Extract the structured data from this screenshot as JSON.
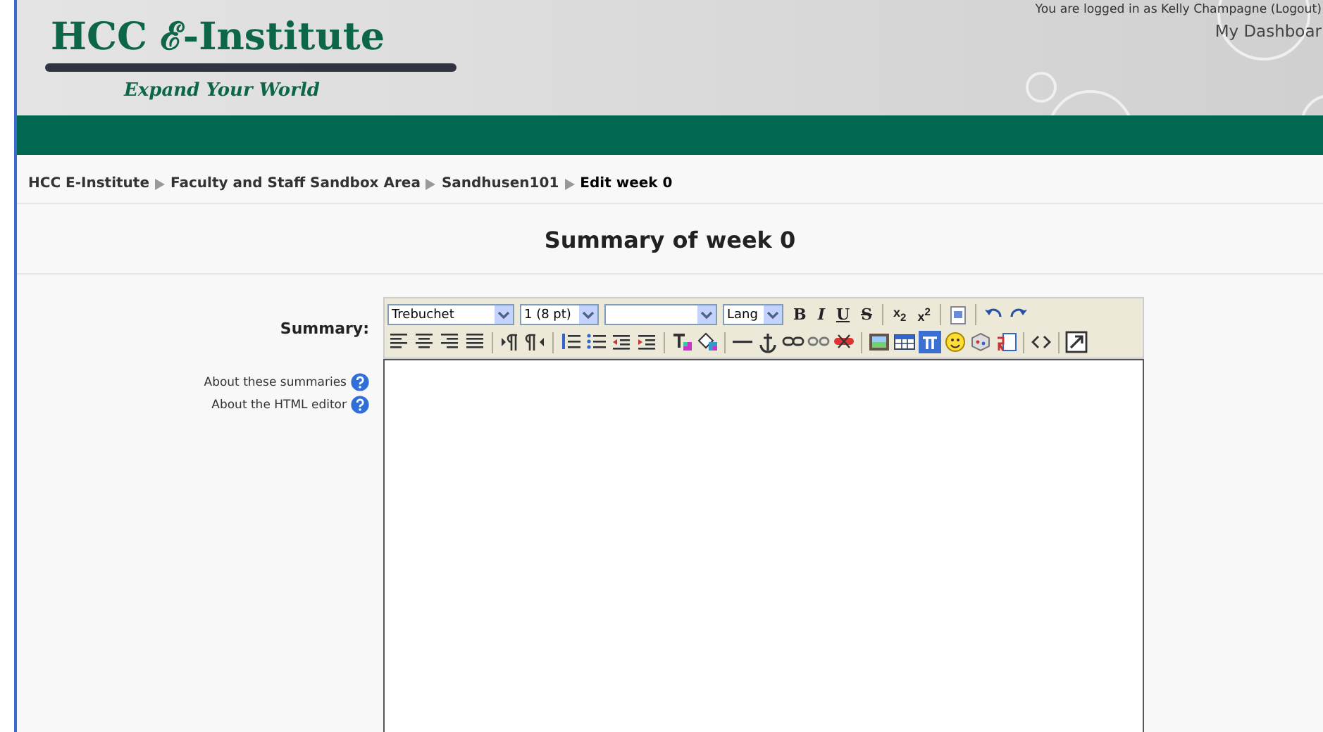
{
  "header": {
    "logo_title": "HCC ℰ-Institute",
    "logo_tagline": "Expand Your World",
    "login_text": "You are logged in as Kelly Champagne (",
    "logout_link": "Logout",
    "login_close": ")",
    "dashboard": "My Dashboar"
  },
  "breadcrumb": [
    {
      "label": "HCC E-Institute",
      "current": false
    },
    {
      "label": "Faculty and Staff Sandbox Area",
      "current": false
    },
    {
      "label": "Sandhusen101",
      "current": false
    },
    {
      "label": "Edit week 0",
      "current": true
    }
  ],
  "heading": "Summary of week 0",
  "form": {
    "label": "Summary:",
    "help_links": [
      "About these summaries",
      "About the HTML editor"
    ]
  },
  "editor": {
    "font": "Trebuchet",
    "size": "1 (8 pt)",
    "lang": "Lang",
    "format_buttons": [
      {
        "label": "B",
        "kind": "bold"
      },
      {
        "label": "I",
        "kind": "italic"
      },
      {
        "label": "U",
        "kind": "underline"
      },
      {
        "label": "S",
        "kind": "strike"
      }
    ],
    "script_buttons": [
      {
        "label": "x",
        "index": "2",
        "sup": false
      },
      {
        "label": "x",
        "index": "2",
        "sup": true
      }
    ]
  }
}
